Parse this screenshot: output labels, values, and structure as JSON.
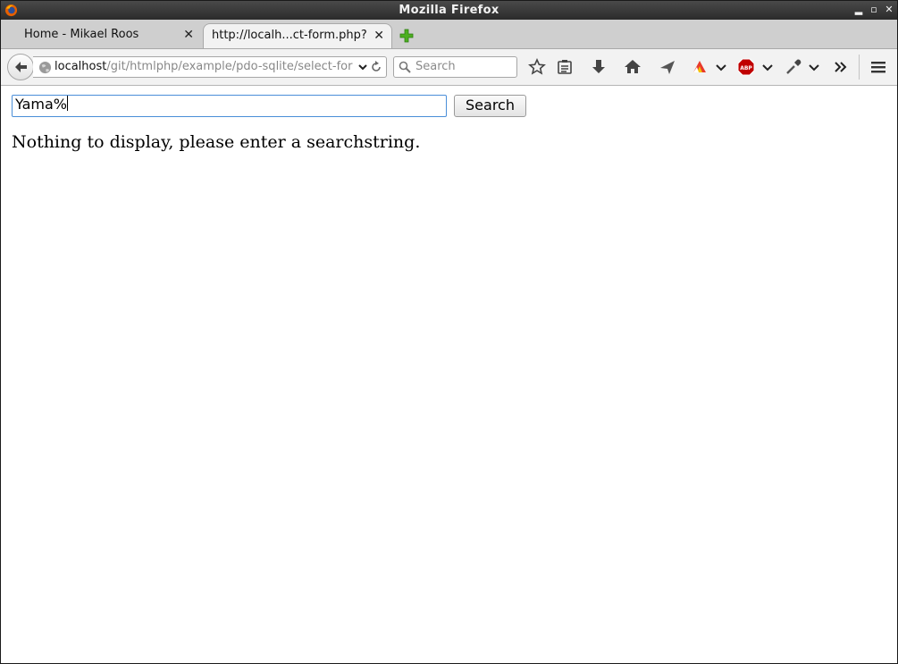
{
  "window": {
    "title": "Mozilla Firefox"
  },
  "tabs": [
    {
      "label": "Home - Mikael Roos",
      "active": false
    },
    {
      "label": "http://localh...ct-form.php?",
      "active": true
    }
  ],
  "navbar": {
    "url_host": "localhost",
    "url_path": "/git/htmlphp/example/pdo-sqlite/select-for",
    "search_placeholder": "Search",
    "icons": [
      "back-icon",
      "globe-icon",
      "url-dropdown-icon",
      "reload-icon",
      "search-icon",
      "bookmark-star-icon",
      "reading-list-icon",
      "download-icon",
      "home-icon",
      "send-icon",
      "extension-icon",
      "adblock-icon",
      "eyedropper-icon",
      "overflow-icon",
      "menu-icon"
    ]
  },
  "page": {
    "search_value": "Yama%",
    "button_label": "Search",
    "message": "Nothing to display, please enter a searchstring."
  },
  "colors": {
    "input_focus_border": "#4a8ed8",
    "titlebar": "#2b2b2b",
    "abp_red": "#c00000"
  }
}
